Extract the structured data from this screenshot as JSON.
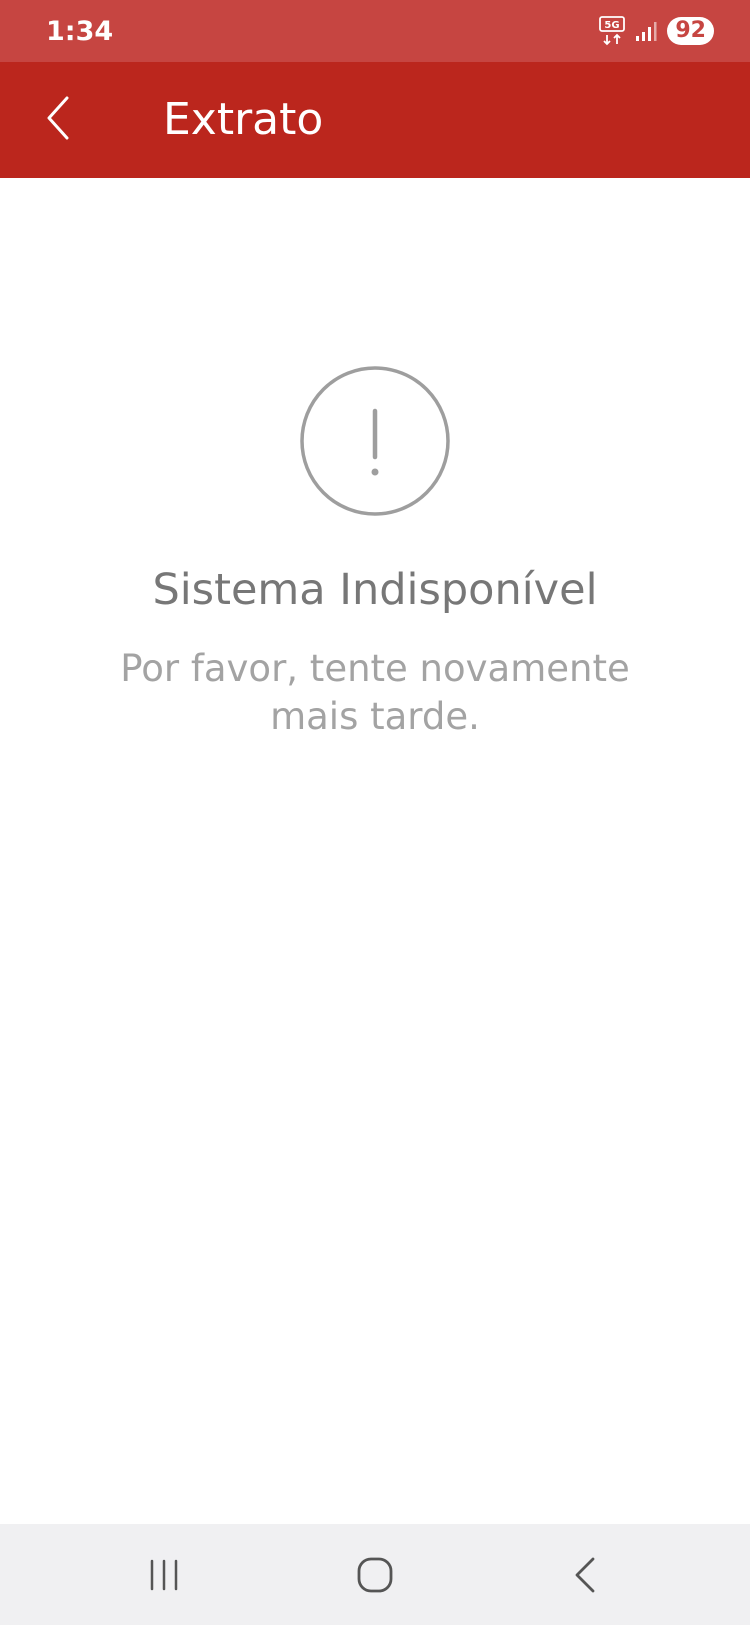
{
  "status_bar": {
    "time": "1:34",
    "network": "5G",
    "battery": "92",
    "icons": [
      "5g-icon",
      "signal-icon"
    ]
  },
  "app_bar": {
    "title": "Extrato",
    "back_icon": "chevron-left-icon"
  },
  "error": {
    "icon": "alert-circle-icon",
    "title": "Sistema Indisponível",
    "message": "Por favor, tente novamente mais tarde."
  },
  "nav_bar": {
    "icons": [
      "recents-icon",
      "home-icon",
      "back-icon"
    ]
  },
  "colors": {
    "status_bar": "#c64541",
    "app_bar": "#bb261d",
    "title_text": "#777777",
    "message_text": "#a3a3a3",
    "icon_stroke": "#9e9e9e",
    "nav_bar": "#f0f0f2"
  }
}
